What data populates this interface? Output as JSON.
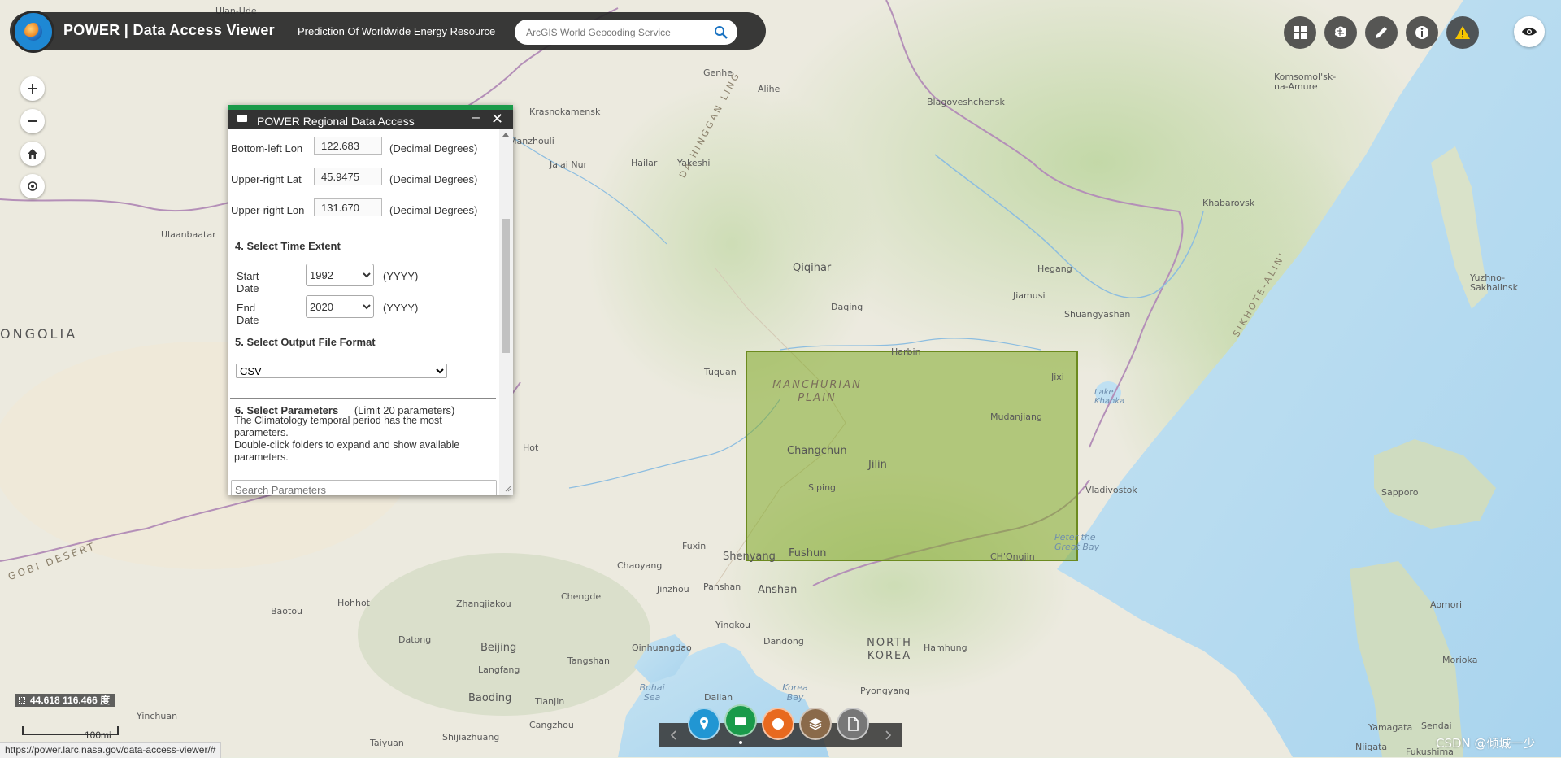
{
  "header": {
    "title": "POWER | Data Access Viewer",
    "subtitle": "Prediction Of Worldwide Energy Resource",
    "search_placeholder": "ArcGIS World Geocoding Service"
  },
  "panel": {
    "title": "POWER Regional Data Access",
    "fields": [
      {
        "label": "Bottom-left Lon",
        "value": "122.683",
        "unit": "(Decimal Degrees)"
      },
      {
        "label": "Upper-right Lat",
        "value": "45.9475",
        "unit": "(Decimal Degrees)"
      },
      {
        "label": "Upper-right Lon",
        "value": "131.670",
        "unit": "(Decimal Degrees)"
      }
    ],
    "time_section": "4. Select Time Extent",
    "start_label": "Start Date",
    "start_value": "1992",
    "end_label": "End Date",
    "end_value": "2020",
    "year_unit": "(YYYY)",
    "format_section": "5. Select Output File Format",
    "format_value": "CSV",
    "params_section": "6. Select Parameters",
    "params_limit": "(Limit 20 parameters)",
    "params_note1": "The Climatology temporal period has the most parameters.",
    "params_note2": "Double-click folders to expand and show available parameters.",
    "params_search_placeholder": "Search Parameters"
  },
  "map": {
    "coordinates": "44.618 116.466 度",
    "scale": "100mi",
    "selection_color": "#82aa28",
    "labels": {
      "ulan_ude": "Ulan-Ude",
      "genhe": "Genhe",
      "krasnokamensk": "Krasnokamensk",
      "alihe": "Alihe",
      "blagoveshchensk": "Blagoveshchensk",
      "komsomolsk": "Komsomol'sk-na-Amure",
      "manzhouli": "Manzhouli",
      "hailar": "Hailar",
      "yakeshi": "Yakeshi",
      "jalai_nur": "Jalai Nur",
      "da_hinggan": "DA HINGGAN LING",
      "khabarovsk": "Khabarovsk",
      "ulaanbaatar": "Ulaanbaatar",
      "qiqihar": "Qiqihar",
      "hegang": "Hegang",
      "jiamusi": "Jiamusi",
      "shuangyashan": "Shuangyashan",
      "daqing": "Daqing",
      "sikhote": "SIKHOTE-ALIN'",
      "yuzhno": "Yuzhno-Sakhalinsk",
      "mongolia": "ONGOLIA",
      "harbin": "Harbin",
      "tuquan": "Tuquan",
      "manchurian": "MANCHURIAN PLAIN",
      "jixi": "Jixi",
      "khanka": "Lake Khanka",
      "mudanjiang": "Mudanjiang",
      "changchun": "Changchun",
      "jilin": "Jilin",
      "siping": "Siping",
      "hot": "Hot",
      "vladivostok": "Vladivostok",
      "sapporo": "Sapporo",
      "gobi": "GOBI DESERT",
      "peter": "Peter the Great Bay",
      "fuxin": "Fuxin",
      "shenyang": "Shenyang",
      "fushun": "Fushun",
      "chongjin": "CH'Ongjin",
      "chaoyang": "Chaoyang",
      "jinzhou": "Jinzhou",
      "panshan": "Panshan",
      "anshan": "Anshan",
      "chengde": "Chengde",
      "zhangjiakou": "Zhangjiakou",
      "hohhot": "Hohhot",
      "baotou": "Baotou",
      "datong": "Datong",
      "yingkou": "Yingkou",
      "north_korea": "NORTH KOREA",
      "aomori": "Aomori",
      "hamhung": "Hamhung",
      "dandong": "Dandong",
      "qinhuangdao": "Qinhuangdao",
      "beijing": "Beijing",
      "langfang": "Langfang",
      "tangshan": "Tangshan",
      "morioka": "Morioka",
      "bohai": "Bohai Sea",
      "korea_bay": "Korea Bay",
      "pyongyang": "Pyongyang",
      "baoding": "Baoding",
      "tianjin": "Tianjin",
      "dalian": "Dalian",
      "yinchuan": "Yinchuan",
      "cangzhou": "Cangzhou",
      "yamagata": "Yamagata",
      "sendai": "Sendai",
      "taiyuan": "Taiyuan",
      "shijiazhuang": "Shijiazhuang",
      "niigata": "Niigata",
      "fukushima": "Fukushima"
    }
  },
  "status_url": "https://power.larc.nasa.gov/data-access-viewer/#",
  "watermark": "CSDN @倾城一少",
  "tool_colors": {
    "point": "#2196d3",
    "region": "#1a9a4a",
    "global": "#e8691f",
    "layers": "#8a6a4a",
    "doc": "#777777"
  }
}
